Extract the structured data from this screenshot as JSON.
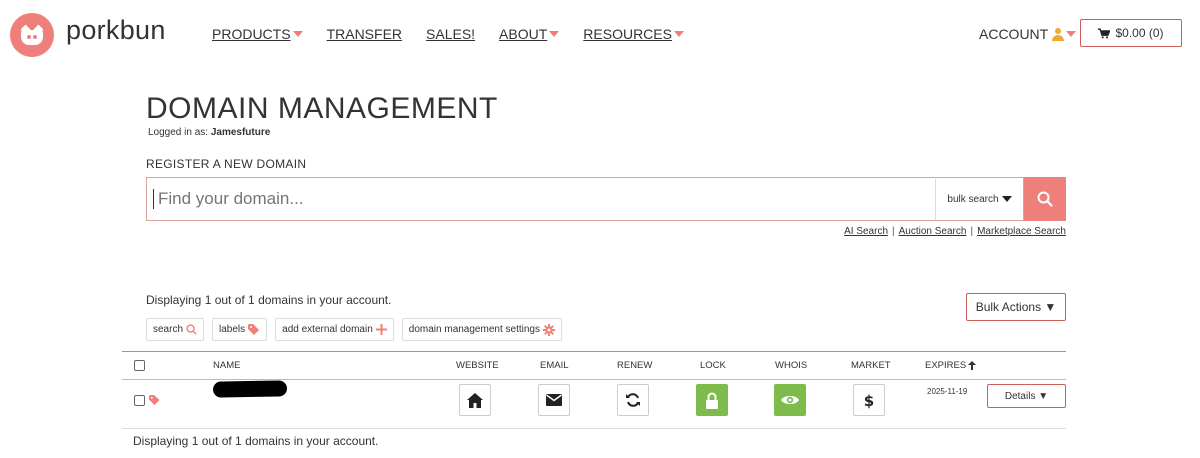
{
  "header": {
    "brand": "porkbun",
    "nav": [
      {
        "label": "PRODUCTS",
        "dropdown": true
      },
      {
        "label": "TRANSFER",
        "dropdown": false
      },
      {
        "label": "SALES!",
        "dropdown": false
      },
      {
        "label": "ABOUT",
        "dropdown": true
      },
      {
        "label": "RESOURCES",
        "dropdown": true
      }
    ],
    "account_label": "ACCOUNT",
    "cart_label": "$0.00 (0)"
  },
  "page": {
    "title": "DOMAIN MANAGEMENT",
    "logged_in_prefix": "Logged in as:",
    "username": "Jamesfuture",
    "register_label": "REGISTER A NEW DOMAIN"
  },
  "search": {
    "placeholder": "Find your domain...",
    "bulk_label": "bulk search",
    "links": [
      "AI Search",
      "Auction Search",
      "Marketplace Search"
    ]
  },
  "domains": {
    "display_text": "Displaying 1 out of 1 domains in your account.",
    "bulk_actions_label": "Bulk Actions ▼",
    "filters": [
      {
        "label": "search",
        "icon": "search-icon"
      },
      {
        "label": "labels",
        "icon": "tag-icon"
      },
      {
        "label": "add external domain",
        "icon": "plus-icon"
      },
      {
        "label": "domain management settings",
        "icon": "gear-icon"
      }
    ],
    "columns": {
      "name": "NAME",
      "website": "WEBSITE",
      "email": "EMAIL",
      "renew": "RENEW",
      "lock": "LOCK",
      "whois": "WHOIS",
      "market": "MARKET",
      "expires": "EXPIRES"
    },
    "rows": [
      {
        "expires": "2025-11-19",
        "details_label": "Details ▼"
      }
    ]
  },
  "colors": {
    "accent": "#ef7f7a",
    "green": "#7dbb4b",
    "user_icon": "#f0a830"
  }
}
